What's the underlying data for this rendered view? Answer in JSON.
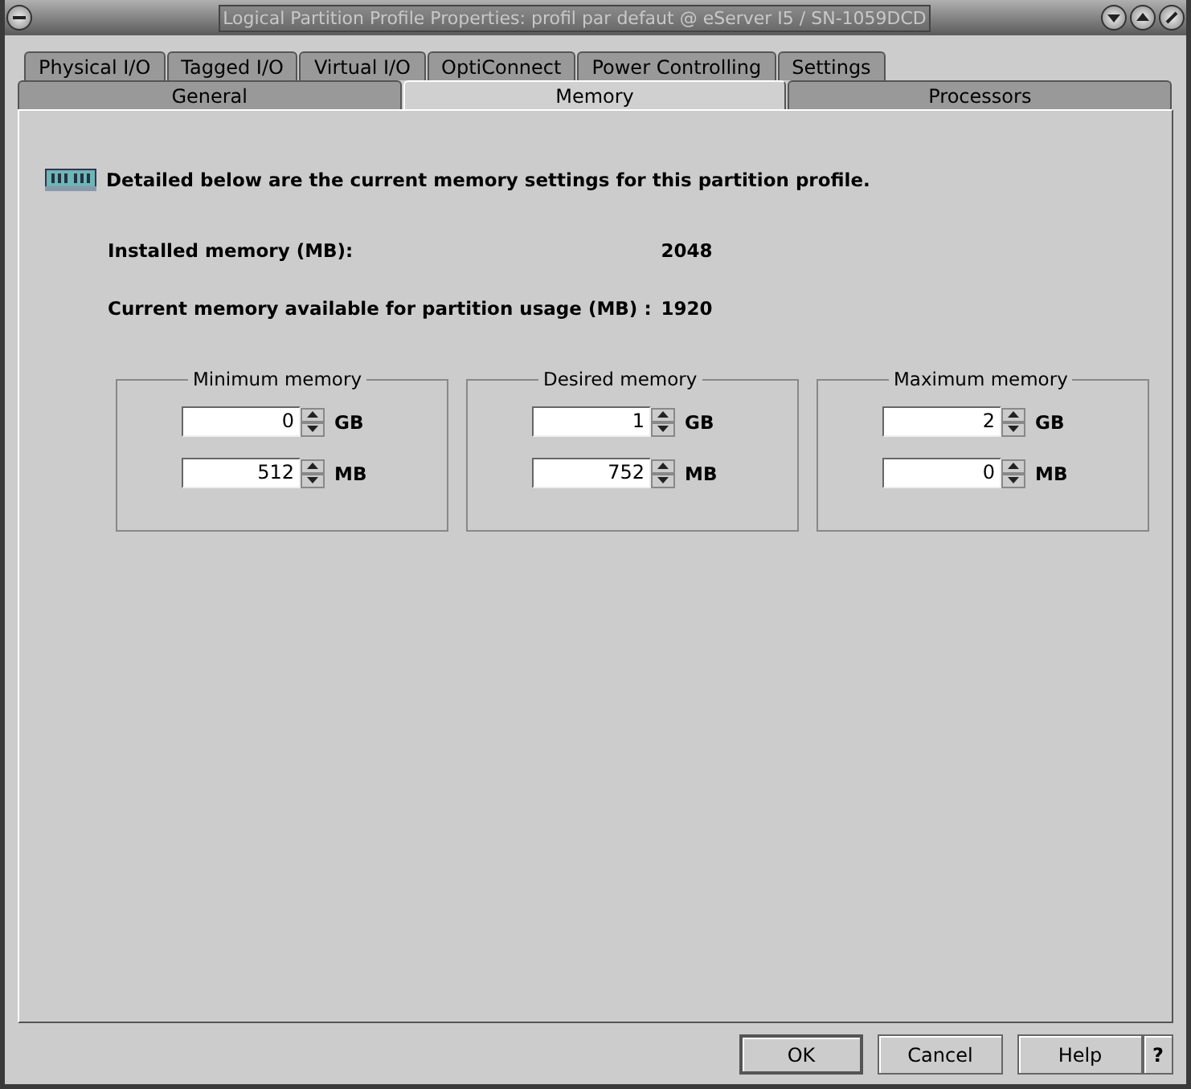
{
  "window": {
    "title": "Logical Partition Profile Properties: profil par defaut @ eServer I5 / SN-1059DCD"
  },
  "tab_rows": [
    {
      "tabs": [
        {
          "label": "Physical I/O",
          "selected": false
        },
        {
          "label": "Tagged I/O",
          "selected": false
        },
        {
          "label": "Virtual I/O",
          "selected": false
        },
        {
          "label": "OptiConnect",
          "selected": false
        },
        {
          "label": "Power Controlling",
          "selected": false
        },
        {
          "label": "Settings",
          "selected": false
        }
      ]
    },
    {
      "tabs": [
        {
          "label": "General",
          "selected": false
        },
        {
          "label": "Memory",
          "selected": true
        },
        {
          "label": "Processors",
          "selected": false
        }
      ]
    }
  ],
  "intro": "Detailed below are the current memory settings for this partition profile.",
  "info": [
    {
      "label": "Installed memory (MB):",
      "value": "2048"
    },
    {
      "label": "Current memory available for partition usage (MB) :",
      "value": "1920"
    }
  ],
  "groups": [
    {
      "title": "Minimum memory",
      "fields": [
        {
          "value": "0",
          "unit": "GB"
        },
        {
          "value": "512",
          "unit": "MB"
        }
      ]
    },
    {
      "title": "Desired memory",
      "fields": [
        {
          "value": "1",
          "unit": "GB"
        },
        {
          "value": "752",
          "unit": "MB"
        }
      ]
    },
    {
      "title": "Maximum memory",
      "fields": [
        {
          "value": "2",
          "unit": "GB"
        },
        {
          "value": "0",
          "unit": "MB"
        }
      ]
    }
  ],
  "buttons": [
    {
      "label": "OK",
      "kind": "default"
    },
    {
      "label": "Cancel",
      "kind": "normal"
    },
    {
      "label": "Help",
      "kind": "normal"
    },
    {
      "label": "?",
      "kind": "small"
    }
  ]
}
